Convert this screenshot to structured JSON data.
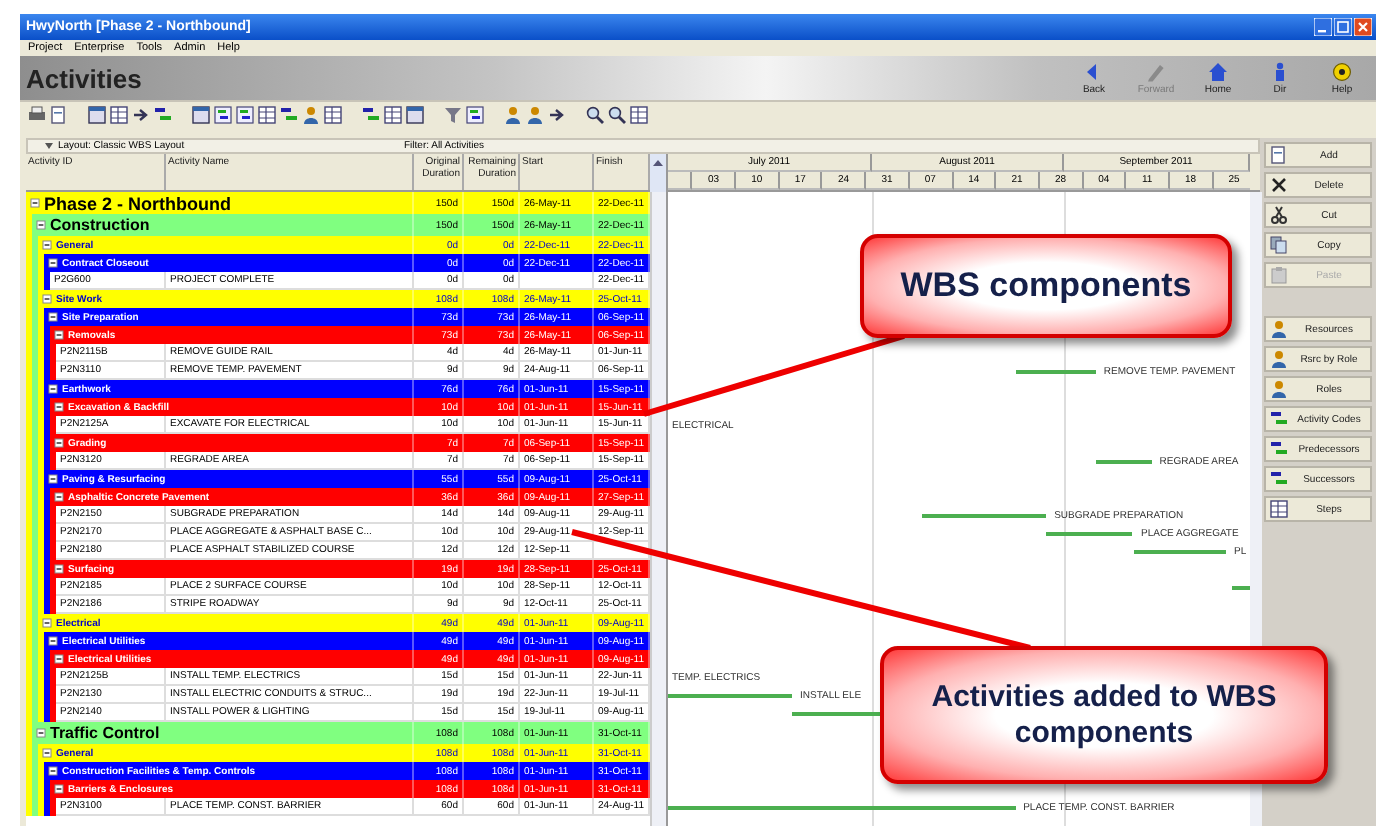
{
  "window": {
    "title": "HwyNorth [Phase 2 - Northbound]"
  },
  "menu": [
    "Project",
    "Enterprise",
    "Tools",
    "Admin",
    "Help"
  ],
  "header": {
    "title": "Activities"
  },
  "nav": [
    {
      "label": "Back",
      "disabled": false
    },
    {
      "label": "Forward",
      "disabled": true
    },
    {
      "label": "Home",
      "disabled": false
    },
    {
      "label": "Dir",
      "disabled": false
    },
    {
      "label": "Help",
      "disabled": false
    }
  ],
  "layout_bar": {
    "layout": "Layout: Classic WBS Layout",
    "filter": "Filter: All Activities"
  },
  "columns": [
    "Activity ID",
    "Activity Name",
    "Original Duration",
    "Remaining Duration",
    "Start",
    "Finish"
  ],
  "timeline": {
    "months": [
      "July 2011",
      "August 2011",
      "September 2011"
    ],
    "weeks": [
      "03",
      "10",
      "17",
      "24",
      "31",
      "07",
      "14",
      "21",
      "28",
      "04",
      "11",
      "18",
      "25"
    ]
  },
  "wbs": [
    {
      "kind": "wbs",
      "name": "Phase 2 - Northbound",
      "orig": "150d",
      "rem": "150d",
      "start": "26-May-11",
      "finish": "22-Dec-11",
      "expanded": true,
      "children": [
        {
          "kind": "wbs",
          "name": "Construction",
          "orig": "150d",
          "rem": "150d",
          "start": "26-May-11",
          "finish": "22-Dec-11",
          "expanded": true,
          "children": [
            {
              "kind": "wbs",
              "name": "General",
              "orig": "0d",
              "rem": "0d",
              "start": "22-Dec-11",
              "finish": "22-Dec-11",
              "expanded": true,
              "children": [
                {
                  "kind": "wbs",
                  "name": "Contract Closeout",
                  "orig": "0d",
                  "rem": "0d",
                  "start": "22-Dec-11",
                  "finish": "22-Dec-11",
                  "expanded": true,
                  "children": [
                    {
                      "kind": "activity",
                      "id": "P2G600",
                      "name": "PROJECT COMPLETE",
                      "orig": "0d",
                      "rem": "0d",
                      "finish": "22-Dec-11"
                    }
                  ]
                }
              ]
            },
            {
              "kind": "wbs",
              "name": "Site Work",
              "orig": "108d",
              "rem": "108d",
              "start": "26-May-11",
              "finish": "25-Oct-11",
              "expanded": true,
              "children": [
                {
                  "kind": "wbs",
                  "name": "Site Preparation",
                  "orig": "73d",
                  "rem": "73d",
                  "start": "26-May-11",
                  "finish": "06-Sep-11",
                  "expanded": true,
                  "children": [
                    {
                      "kind": "wbs",
                      "name": "Removals",
                      "orig": "73d",
                      "rem": "73d",
                      "start": "26-May-11",
                      "finish": "06-Sep-11",
                      "expanded": true,
                      "children": [
                        {
                          "kind": "activity",
                          "id": "P2N2115B",
                          "name": "REMOVE GUIDE RAIL",
                          "orig": "4d",
                          "rem": "4d",
                          "start": "26-May-11",
                          "finish": "01-Jun-11"
                        },
                        {
                          "kind": "activity",
                          "id": "P2N3110",
                          "name": "REMOVE TEMP. PAVEMENT",
                          "orig": "9d",
                          "rem": "9d",
                          "start": "24-Aug-11",
                          "finish": "06-Sep-11",
                          "bar_label": "REMOVE TEMP. PAVEMENT"
                        }
                      ]
                    }
                  ]
                },
                {
                  "kind": "wbs",
                  "name": "Earthwork",
                  "orig": "76d",
                  "rem": "76d",
                  "start": "01-Jun-11",
                  "finish": "15-Sep-11",
                  "expanded": true,
                  "children": [
                    {
                      "kind": "wbs",
                      "name": "Excavation & Backfill",
                      "orig": "10d",
                      "rem": "10d",
                      "start": "01-Jun-11",
                      "finish": "15-Jun-11",
                      "expanded": true,
                      "children": [
                        {
                          "kind": "activity",
                          "id": "P2N2125A",
                          "name": "EXCAVATE FOR ELECTRICAL",
                          "orig": "10d",
                          "rem": "10d",
                          "start": "01-Jun-11",
                          "finish": "15-Jun-11",
                          "bar_label": "ELECTRICAL"
                        }
                      ]
                    },
                    {
                      "kind": "wbs",
                      "name": "Grading",
                      "orig": "7d",
                      "rem": "7d",
                      "start": "06-Sep-11",
                      "finish": "15-Sep-11",
                      "expanded": true,
                      "children": [
                        {
                          "kind": "activity",
                          "id": "P2N3120",
                          "name": "REGRADE AREA",
                          "orig": "7d",
                          "rem": "7d",
                          "start": "06-Sep-11",
                          "finish": "15-Sep-11",
                          "bar_label": "REGRADE AREA"
                        }
                      ]
                    }
                  ]
                },
                {
                  "kind": "wbs",
                  "name": "Paving & Resurfacing",
                  "orig": "55d",
                  "rem": "55d",
                  "start": "09-Aug-11",
                  "finish": "25-Oct-11",
                  "expanded": true,
                  "children": [
                    {
                      "kind": "wbs",
                      "name": "Asphaltic Concrete Pavement",
                      "orig": "36d",
                      "rem": "36d",
                      "start": "09-Aug-11",
                      "finish": "27-Sep-11",
                      "expanded": true,
                      "children": [
                        {
                          "kind": "activity",
                          "id": "P2N2150",
                          "name": "SUBGRADE PREPARATION",
                          "orig": "14d",
                          "rem": "14d",
                          "start": "09-Aug-11",
                          "finish": "29-Aug-11",
                          "bar_label": "SUBGRADE PREPARATION"
                        },
                        {
                          "kind": "activity",
                          "id": "P2N2170",
                          "name": "PLACE AGGREGATE & ASPHALT BASE C...",
                          "orig": "10d",
                          "rem": "10d",
                          "start": "29-Aug-11",
                          "finish": "12-Sep-11",
                          "bar_label": "PLACE AGGREGATE"
                        },
                        {
                          "kind": "activity",
                          "id": "P2N2180",
                          "name": "PLACE ASPHALT STABILIZED COURSE",
                          "orig": "12d",
                          "rem": "12d",
                          "start": "12-Sep-11",
                          "bar_label": "PL"
                        }
                      ]
                    },
                    {
                      "kind": "wbs",
                      "name": "Surfacing",
                      "orig": "19d",
                      "rem": "19d",
                      "start": "28-Sep-11",
                      "finish": "25-Oct-11",
                      "expanded": true,
                      "children": [
                        {
                          "kind": "activity",
                          "id": "P2N2185",
                          "name": "PLACE 2 SURFACE COURSE",
                          "orig": "10d",
                          "rem": "10d",
                          "start": "28-Sep-11",
                          "finish": "12-Oct-11"
                        },
                        {
                          "kind": "activity",
                          "id": "P2N2186",
                          "name": "STRIPE ROADWAY",
                          "orig": "9d",
                          "rem": "9d",
                          "start": "12-Oct-11",
                          "finish": "25-Oct-11"
                        }
                      ]
                    }
                  ]
                }
              ]
            },
            {
              "kind": "wbs",
              "name": "Electrical",
              "orig": "49d",
              "rem": "49d",
              "start": "01-Jun-11",
              "finish": "09-Aug-11",
              "expanded": true,
              "children": [
                {
                  "kind": "wbs",
                  "name": "Electrical Utilities",
                  "orig": "49d",
                  "rem": "49d",
                  "start": "01-Jun-11",
                  "finish": "09-Aug-11",
                  "expanded": true,
                  "children": [
                    {
                      "kind": "wbs",
                      "name": "Electrical Utilities",
                      "orig": "49d",
                      "rem": "49d",
                      "start": "01-Jun-11",
                      "finish": "09-Aug-11",
                      "expanded": true,
                      "children": [
                        {
                          "kind": "activity",
                          "id": "P2N2125B",
                          "name": "INSTALL TEMP. ELECTRICS",
                          "orig": "15d",
                          "rem": "15d",
                          "start": "01-Jun-11",
                          "finish": "22-Jun-11",
                          "bar_label": "TEMP. ELECTRICS"
                        },
                        {
                          "kind": "activity",
                          "id": "P2N2130",
                          "name": "INSTALL ELECTRIC CONDUITS & STRUC...",
                          "orig": "19d",
                          "rem": "19d",
                          "start": "22-Jun-11",
                          "finish": "19-Jul-11",
                          "bar_label": "INSTALL ELE"
                        },
                        {
                          "kind": "activity",
                          "id": "P2N2140",
                          "name": "INSTALL POWER & LIGHTING",
                          "orig": "15d",
                          "rem": "15d",
                          "start": "19-Jul-11",
                          "finish": "09-Aug-11"
                        }
                      ]
                    }
                  ]
                }
              ]
            }
          ]
        },
        {
          "kind": "wbs",
          "name": "Traffic Control",
          "orig": "108d",
          "rem": "108d",
          "start": "01-Jun-11",
          "finish": "31-Oct-11",
          "expanded": true,
          "children": [
            {
              "kind": "wbs",
              "name": "General",
              "orig": "108d",
              "rem": "108d",
              "start": "01-Jun-11",
              "finish": "31-Oct-11",
              "expanded": true,
              "children": [
                {
                  "kind": "wbs",
                  "name": "Construction Facilities & Temp. Controls",
                  "orig": "108d",
                  "rem": "108d",
                  "start": "01-Jun-11",
                  "finish": "31-Oct-11",
                  "expanded": true,
                  "children": [
                    {
                      "kind": "wbs",
                      "name": "Barriers & Enclosures",
                      "orig": "108d",
                      "rem": "108d",
                      "start": "01-Jun-11",
                      "finish": "31-Oct-11",
                      "expanded": true,
                      "children": [
                        {
                          "kind": "activity",
                          "id": "P2N3100",
                          "name": "PLACE TEMP. CONST. BARRIER",
                          "orig": "60d",
                          "rem": "60d",
                          "start": "01-Jun-11",
                          "finish": "24-Aug-11",
                          "bar_label": "PLACE TEMP. CONST. BARRIER"
                        }
                      ]
                    }
                  ]
                }
              ]
            }
          ]
        }
      ]
    }
  ],
  "edit_buttons": [
    {
      "label": "Add",
      "disabled": false
    },
    {
      "label": "Delete",
      "disabled": false
    },
    {
      "label": "Cut",
      "disabled": false
    },
    {
      "label": "Copy",
      "disabled": false
    },
    {
      "label": "Paste",
      "disabled": true
    }
  ],
  "detail_buttons": [
    {
      "label": "Resources"
    },
    {
      "label": "Rsrc by Role"
    },
    {
      "label": "Roles"
    },
    {
      "label": "Activity Codes"
    },
    {
      "label": "Predecessors"
    },
    {
      "label": "Successors"
    },
    {
      "label": "Steps"
    }
  ],
  "callouts": [
    {
      "text": "WBS components"
    },
    {
      "text": "Activities added to WBS components"
    }
  ]
}
